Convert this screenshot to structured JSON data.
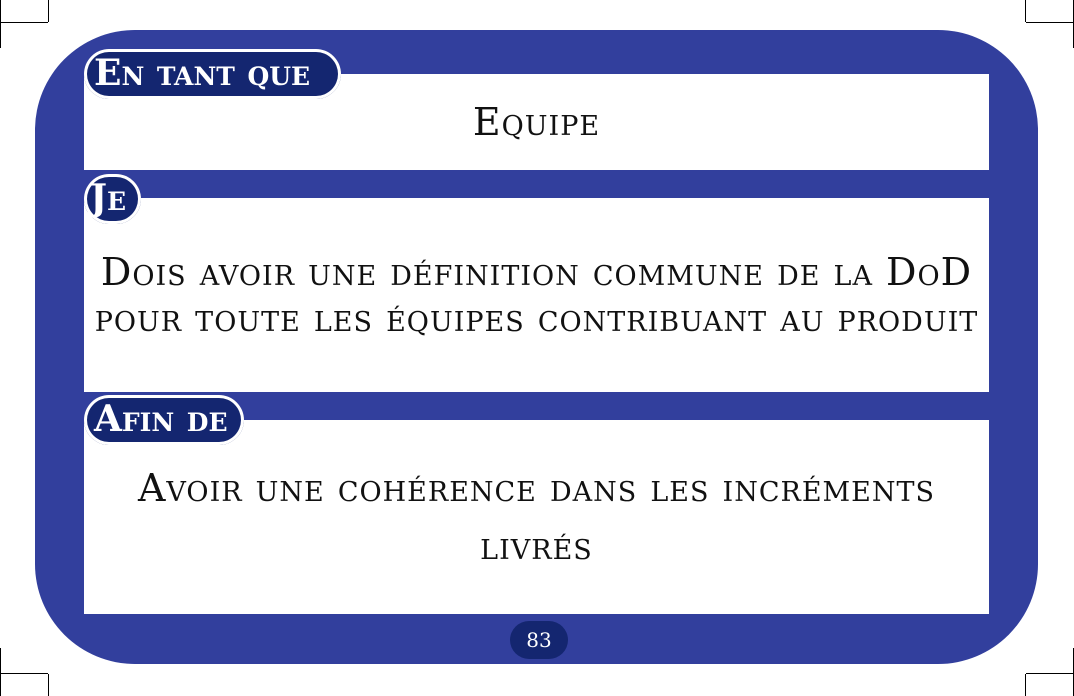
{
  "card": {
    "role_label": "En tant que",
    "role_text": "Equipe",
    "want_label": "Je",
    "want_text": "Dois avoir une définition commune de la DoD pour toute les équipes contribuant au produit",
    "goal_label": "Afin de",
    "goal_text": "Avoir une cohérence dans les incréments livrés",
    "page_number": "83"
  },
  "colors": {
    "card_background": "#323f9d",
    "label_background": "#142670",
    "box_background": "#ffffff",
    "text": "#111111"
  }
}
